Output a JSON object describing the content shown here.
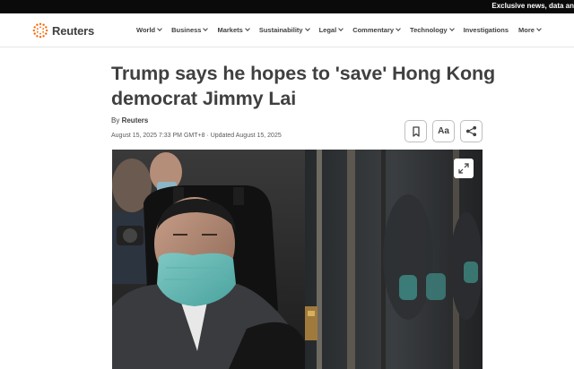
{
  "topbar": {
    "promo_text": "Exclusive news, data an"
  },
  "brand": {
    "name": "Reuters",
    "accent": "#fa6400"
  },
  "nav": {
    "items": [
      {
        "label": "World",
        "has_menu": true
      },
      {
        "label": "Business",
        "has_menu": true
      },
      {
        "label": "Markets",
        "has_menu": true
      },
      {
        "label": "Sustainability",
        "has_menu": true
      },
      {
        "label": "Legal",
        "has_menu": true
      },
      {
        "label": "Commentary",
        "has_menu": true
      },
      {
        "label": "Technology",
        "has_menu": true
      },
      {
        "label": "Investigations",
        "has_menu": false
      },
      {
        "label": "More",
        "has_menu": true
      }
    ]
  },
  "article": {
    "headline_line1": "Trump says he hopes to 'save' Hong Kong",
    "headline_line2": "democrat Jimmy Lai",
    "byline_prefix": "By",
    "byline_author": "Reuters",
    "published": "August 15, 2025 7:33 PM GMT+8",
    "separator": " · ",
    "updated": "Updated August 15, 2025"
  },
  "toolbar": {
    "bookmark_icon": "bookmark-icon",
    "text_size_label": "Aa",
    "share_icon": "share-icon"
  },
  "image": {
    "subject": "man-in-mask-in-vehicle",
    "expand_icon": "expand-icon"
  }
}
